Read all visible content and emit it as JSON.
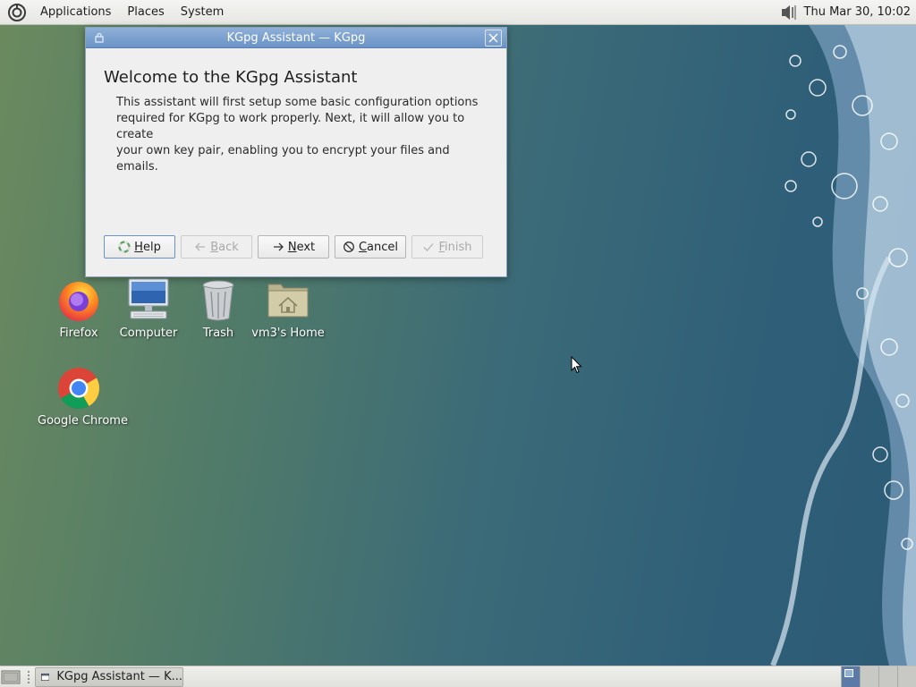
{
  "top_panel": {
    "menus": [
      "Applications",
      "Places",
      "System"
    ],
    "clock": "Thu Mar 30, 10:02"
  },
  "dialog": {
    "title": "KGpg Assistant — KGpg",
    "heading": "Welcome to the KGpg Assistant",
    "body_lines": [
      "This assistant will first setup some basic configuration options",
      "required for KGpg to work properly. Next, it will allow you to create",
      "your own key pair, enabling you to encrypt your files and emails."
    ],
    "buttons": {
      "help": {
        "mnemonic": "H",
        "rest": "elp",
        "enabled": true
      },
      "back": {
        "mnemonic": "B",
        "rest": "ack",
        "enabled": false
      },
      "next": {
        "mnemonic": "N",
        "rest": "ext",
        "enabled": true
      },
      "cancel": {
        "mnemonic": "C",
        "rest": "ancel",
        "enabled": true
      },
      "finish": {
        "mnemonic": "F",
        "rest": "inish",
        "enabled": false
      }
    }
  },
  "desktop_icons": [
    {
      "label": "Firefox",
      "icon": "firefox-icon"
    },
    {
      "label": "Computer",
      "icon": "computer-icon"
    },
    {
      "label": "Trash",
      "icon": "trash-icon"
    },
    {
      "label": "vm3's Home",
      "icon": "home-folder-icon"
    },
    {
      "label": "Google Chrome",
      "icon": "chrome-icon"
    }
  ],
  "taskbar": {
    "windows": [
      {
        "label": "KGpg Assistant — K..."
      }
    ],
    "workspaces": 4,
    "active_workspace": 1
  },
  "colors": {
    "titlebar": "#6a93c6",
    "panel": "#e6e6e3"
  }
}
